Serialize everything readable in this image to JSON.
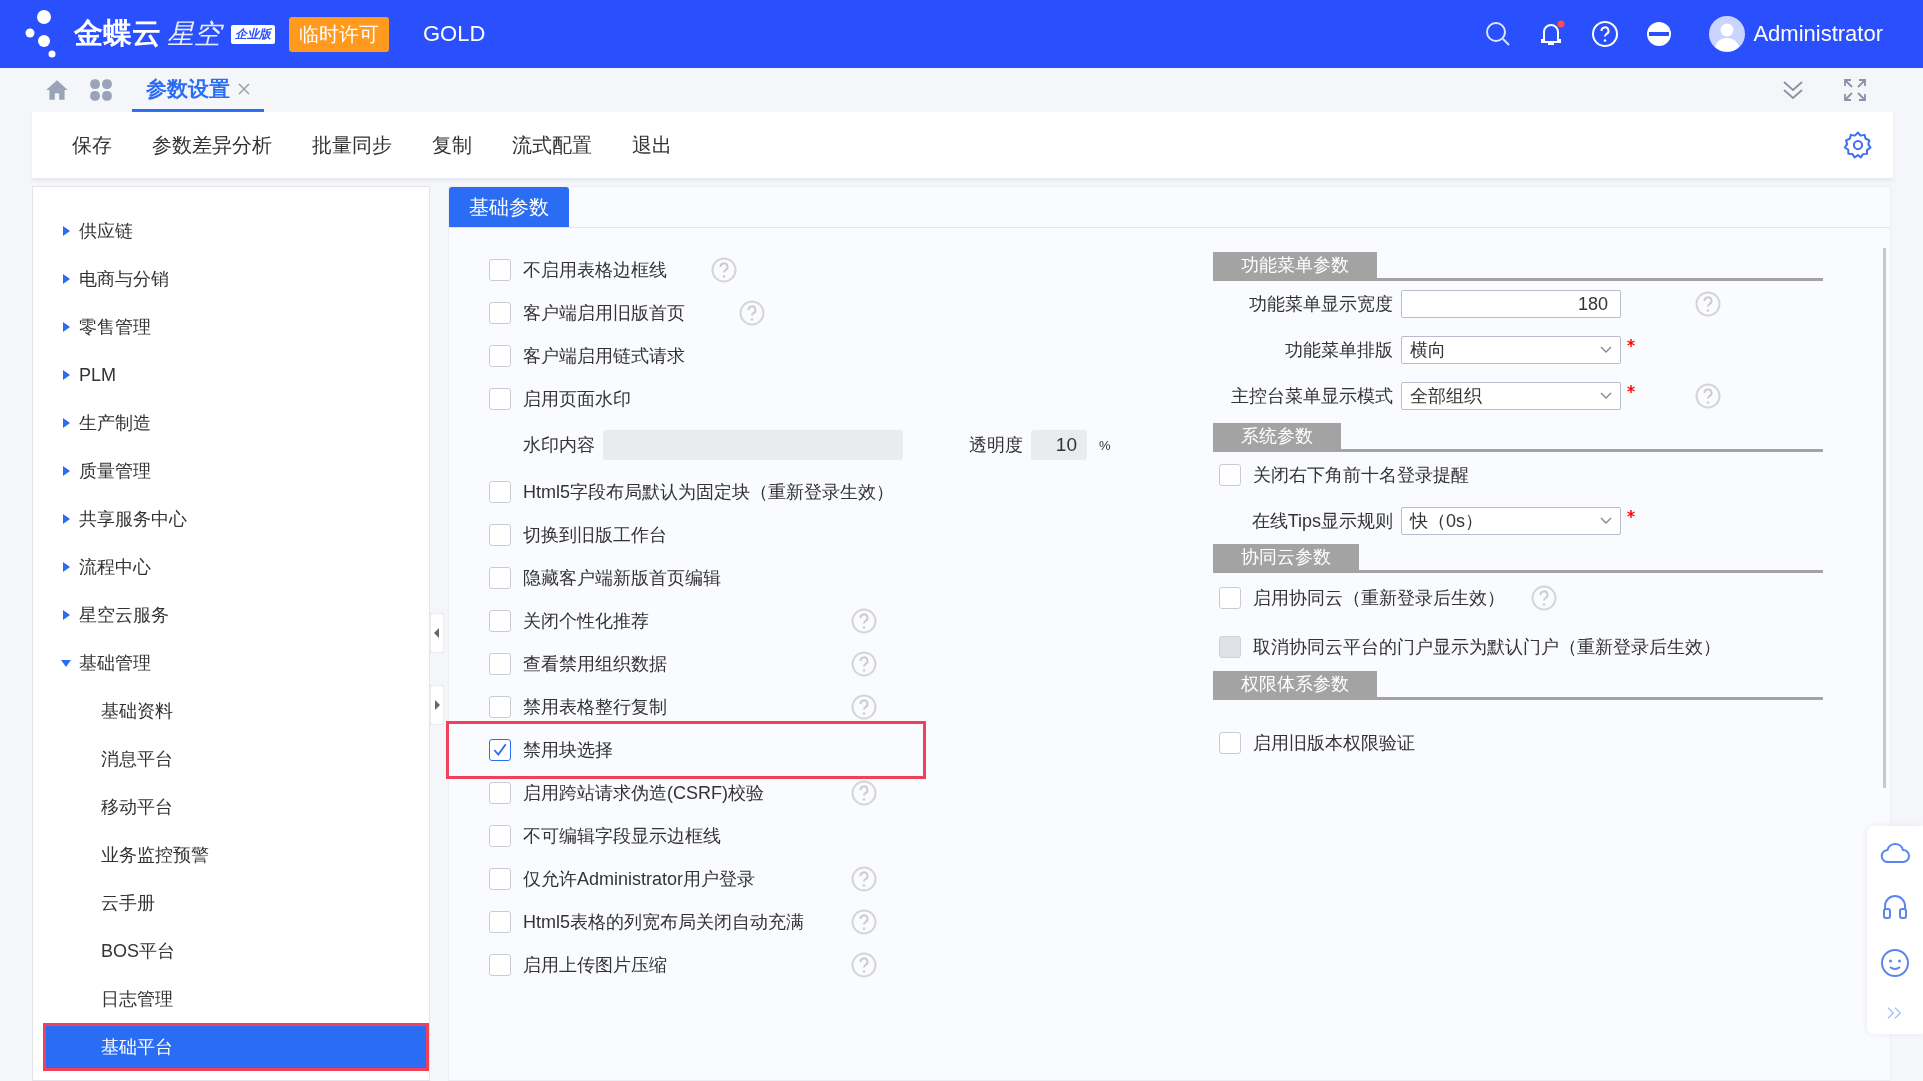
{
  "header": {
    "brand": "金蝶云",
    "product": "星空",
    "edition": "企业版",
    "license": "临时许可",
    "tier": "GOLD",
    "user": "Administrator",
    "notification_dot": true
  },
  "tabs": [
    {
      "label": "参数设置",
      "selected": true
    }
  ],
  "toolbar": [
    "保存",
    "参数差异分析",
    "批量同步",
    "复制",
    "流式配置",
    "退出"
  ],
  "sidebar": {
    "items": [
      {
        "label": "供应链",
        "expanded": false
      },
      {
        "label": "电商与分销",
        "expanded": false
      },
      {
        "label": "零售管理",
        "expanded": false
      },
      {
        "label": "PLM",
        "expanded": false
      },
      {
        "label": "生产制造",
        "expanded": false
      },
      {
        "label": "质量管理",
        "expanded": false
      },
      {
        "label": "共享服务中心",
        "expanded": false
      },
      {
        "label": "流程中心",
        "expanded": false
      },
      {
        "label": "星空云服务",
        "expanded": false
      },
      {
        "label": "基础管理",
        "expanded": true,
        "children": [
          {
            "label": "基础资料",
            "selected": false,
            "highlighted": false
          },
          {
            "label": "消息平台",
            "selected": false,
            "highlighted": false
          },
          {
            "label": "移动平台",
            "selected": false,
            "highlighted": false
          },
          {
            "label": "业务监控预警",
            "selected": false,
            "highlighted": false
          },
          {
            "label": "云手册",
            "selected": false,
            "highlighted": false
          },
          {
            "label": "BOS平台",
            "selected": false,
            "highlighted": false
          },
          {
            "label": "日志管理",
            "selected": false,
            "highlighted": false
          },
          {
            "label": "基础平台",
            "selected": true,
            "highlighted": true
          }
        ]
      }
    ]
  },
  "panel_tab": "基础参数",
  "left_options": [
    {
      "kind": "checkbox",
      "label": "不启用表格边框线",
      "checked": false,
      "help": true,
      "highlighted": false
    },
    {
      "kind": "checkbox",
      "label": "客户端启用旧版首页",
      "checked": false,
      "help": true,
      "highlighted": false
    },
    {
      "kind": "checkbox",
      "label": "客户端启用链式请求",
      "checked": false,
      "help": false,
      "highlighted": false
    },
    {
      "kind": "checkbox",
      "label": "启用页面水印",
      "checked": false,
      "help": false,
      "highlighted": false
    },
    {
      "kind": "watermark",
      "label": "水印内容",
      "opacity_label": "透明度",
      "opacity_value": "10",
      "unit": "%"
    },
    {
      "kind": "checkbox",
      "label": "Html5字段布局默认为固定块（重新登录生效）",
      "checked": false,
      "help": false,
      "highlighted": false
    },
    {
      "kind": "checkbox",
      "label": "切换到旧版工作台",
      "checked": false,
      "help": false,
      "highlighted": false
    },
    {
      "kind": "checkbox",
      "label": "隐藏客户端新版首页编辑",
      "checked": false,
      "help": false,
      "highlighted": false
    },
    {
      "kind": "checkbox",
      "label": "关闭个性化推荐",
      "checked": false,
      "help": true,
      "highlighted": false
    },
    {
      "kind": "checkbox",
      "label": "查看禁用组织数据",
      "checked": false,
      "help": true,
      "highlighted": false
    },
    {
      "kind": "checkbox",
      "label": "禁用表格整行复制",
      "checked": false,
      "help": true,
      "highlighted": false
    },
    {
      "kind": "checkbox",
      "label": "禁用块选择",
      "checked": true,
      "help": false,
      "highlighted": true
    },
    {
      "kind": "checkbox",
      "label": "启用跨站请求伪造(CSRF)校验",
      "checked": false,
      "help": true,
      "highlighted": false
    },
    {
      "kind": "checkbox",
      "label": "不可编辑字段显示边框线",
      "checked": false,
      "help": false,
      "highlighted": false
    },
    {
      "kind": "checkbox",
      "label": "仅允许Administrator用户登录",
      "checked": false,
      "help": true,
      "highlighted": false
    },
    {
      "kind": "checkbox",
      "label": "Html5表格的列宽布局关闭自动充满",
      "checked": false,
      "help": true,
      "highlighted": false
    },
    {
      "kind": "checkbox",
      "label": "启用上传图片压缩",
      "checked": false,
      "help": true,
      "highlighted": false
    }
  ],
  "right_sections": [
    {
      "title": "功能菜单参数",
      "items": [
        {
          "kind": "field",
          "label": "功能菜单显示宽度",
          "value": "180",
          "required": false,
          "help": true
        },
        {
          "kind": "select",
          "label": "功能菜单排版",
          "value": "横向",
          "required": true,
          "help": false
        },
        {
          "kind": "select",
          "label": "主控台菜单显示模式",
          "value": "全部组织",
          "required": true,
          "help": true
        }
      ]
    },
    {
      "title": "系统参数",
      "items": [
        {
          "kind": "checkbox",
          "label": "关闭右下角前十名登录提醒",
          "checked": false,
          "disabled": false,
          "help": false
        },
        {
          "kind": "select",
          "label": "在线Tips显示规则",
          "value": "快（0s）",
          "required": true,
          "help": false
        }
      ]
    },
    {
      "title": "协同云参数",
      "items": [
        {
          "kind": "checkbox",
          "label": "启用协同云（重新登录后生效）",
          "checked": false,
          "disabled": false,
          "help": true
        },
        {
          "kind": "checkbox",
          "label": "取消协同云平台的门户显示为默认门户（重新登录后生效）",
          "checked": false,
          "disabled": true,
          "help": false
        }
      ]
    },
    {
      "title": "权限体系参数",
      "items": [
        {
          "kind": "checkbox",
          "label": "启用旧版本权限验证",
          "checked": false,
          "disabled": false,
          "help": false
        }
      ]
    }
  ]
}
